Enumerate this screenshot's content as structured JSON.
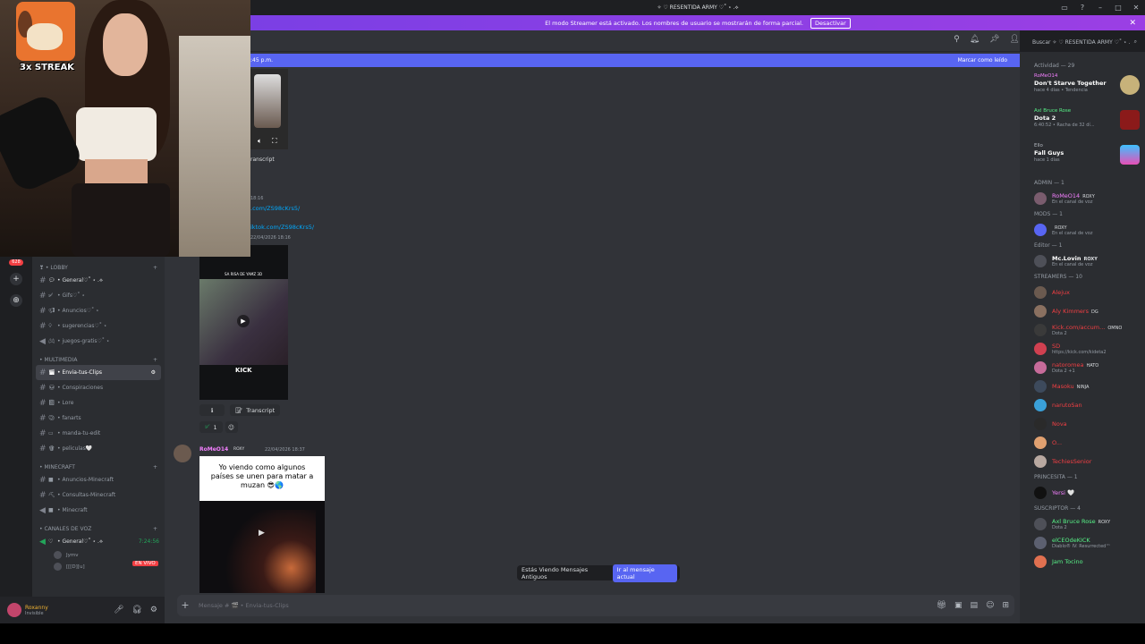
{
  "titlebar": {
    "title": "✧ ♡ RESENTIDA ARMY ♡˚ ⋆ .⟡"
  },
  "banner": {
    "text": "El modo Streamer está activado. Los nombres de usuario se mostrarán de forma parcial.",
    "button": "Desactivar"
  },
  "webcam": {
    "streak": "3x STREAK"
  },
  "rail": {
    "badge": "628"
  },
  "channels": {
    "categories": {
      "lobby": "❣ • LOBBY",
      "multimedia": "• MULTIMEDIA",
      "minecraft": "• MINECRAFT",
      "voz": "• CANALES DE VOZ"
    },
    "items": {
      "general": "• General♡˚ ⋆ .⟡",
      "gifs": "• Gifs♡˚ ⋆",
      "anuncios": "• Anuncios♡˚ ⋆",
      "sugerencias": "• sugerencias♡˚ ⋆",
      "juegos": "• juegos-gratis♡˚ ⋆",
      "clips": "• Envia-tus-Clips",
      "conspiraciones": "• Conspiraciones",
      "lore": "• Lore",
      "fanarts": "• fanarts",
      "edit": "• manda-tu-edit",
      "peliculas": "• peliculas🤍",
      "anunciosmc": "• Anuncios-Minecraft",
      "consultasmc": "• Consultas-Minecraft",
      "minecraft": "• Minecraft",
      "voice_general": "• General♡˚ ⋆ .⟡",
      "voice_time": "7:24:56",
      "live": "EN VIVO",
      "voice_user1": "Jymv",
      "voice_user2": "[[[D][u]"
    }
  },
  "userpanel": {
    "name": "Roxanny",
    "status": "Invisible"
  },
  "chat": {
    "unread_time": ":45 p.m.",
    "mark_read": "Marcar como leído",
    "transcript1": "ranscript",
    "ts1": "18:16",
    "link1": ".com/ZS98cKrs5/",
    "link2": "iktok.com/ZS98cKrs5/",
    "ts2": "22/04/2026 18:16",
    "transcript2": "Transcript",
    "reaction_count": "1",
    "author": "RoMeO14",
    "author_tag": "ROXY",
    "author_ts": "22/04/2026 18:37",
    "caption": "Yo viendo como algunos países se unen para matar a muzan 😎🌎",
    "video_top_text": "SA RISA DE YAMZ 3D",
    "video_kick": "KICK",
    "old_messages": "Estás Viendo Mensajes Antiguos",
    "go_current": "Ir al mensaje actual",
    "input_placeholder": "Mensaje # 🎬 • Envia-tus-Clips"
  },
  "search": {
    "placeholder": "Buscar ✧ ♡ RESENTIDA ARMY ♡˚ ⋆ ."
  },
  "members": {
    "activity_header": "Actividad — 29",
    "activities": [
      {
        "user": "RoMeO14",
        "game": "Don't Starve Together",
        "sub": "hace 4 días  • Tendencia"
      },
      {
        "user": "Axl Bruce Rose",
        "game": "Dota 2",
        "sub": "6:40:52  • Racha de 32 dí..."
      },
      {
        "user": "Ello",
        "game": "Fall Guys",
        "sub": "hace 1 días"
      }
    ],
    "admin_header": "ADMIN — 1",
    "admin": [
      {
        "name": "RoMeO14",
        "tag": "ROXY",
        "status": "En el canal de voz"
      }
    ],
    "mods_header": "MODS — 1",
    "mods": [
      {
        "name": "",
        "tag": "ROXY",
        "status": "En el canal de voz"
      }
    ],
    "editor_header": "Editor — 1",
    "editor": [
      {
        "name": "Mc.Lovin",
        "tag": "ROXY",
        "status": "En el canal de voz"
      }
    ],
    "streamers_header": "STREAMERS — 10",
    "streamers": [
      {
        "name": "Alejux",
        "tag": "",
        "status": ""
      },
      {
        "name": "Aly Kimmers",
        "tag": "DG",
        "status": ""
      },
      {
        "name": "Kick.com/accum...",
        "tag": "OMNO",
        "status": "Dota 2"
      },
      {
        "name": "SD",
        "tag": "",
        "status": "https://kick.com/kideta2"
      },
      {
        "name": "natoromea",
        "tag": "HATO",
        "status": "Dota 2 +1"
      },
      {
        "name": "Masoku",
        "tag": "NINJA",
        "status": ""
      },
      {
        "name": "narutoSan",
        "tag": "",
        "status": ""
      },
      {
        "name": "Nova",
        "tag": "",
        "status": ""
      },
      {
        "name": "O...",
        "tag": "",
        "status": ""
      },
      {
        "name": "TechiesSenior",
        "tag": "",
        "status": ""
      }
    ],
    "princesita_header": "PRINCESITA — 1",
    "princesita": [
      {
        "name": "Yersi 🤍",
        "tag": "",
        "status": ""
      }
    ],
    "suscriptor_header": "SUSCRIPTOR — 4",
    "suscriptor": [
      {
        "name": "Axl Bruce Rose",
        "tag": "ROXY",
        "status": "Dota 2"
      },
      {
        "name": "elCEOdeKICK",
        "tag": "",
        "status": "Diablo® IV: Resurrected™"
      },
      {
        "name": "Jam Tocino",
        "tag": "",
        "status": ""
      }
    ]
  }
}
